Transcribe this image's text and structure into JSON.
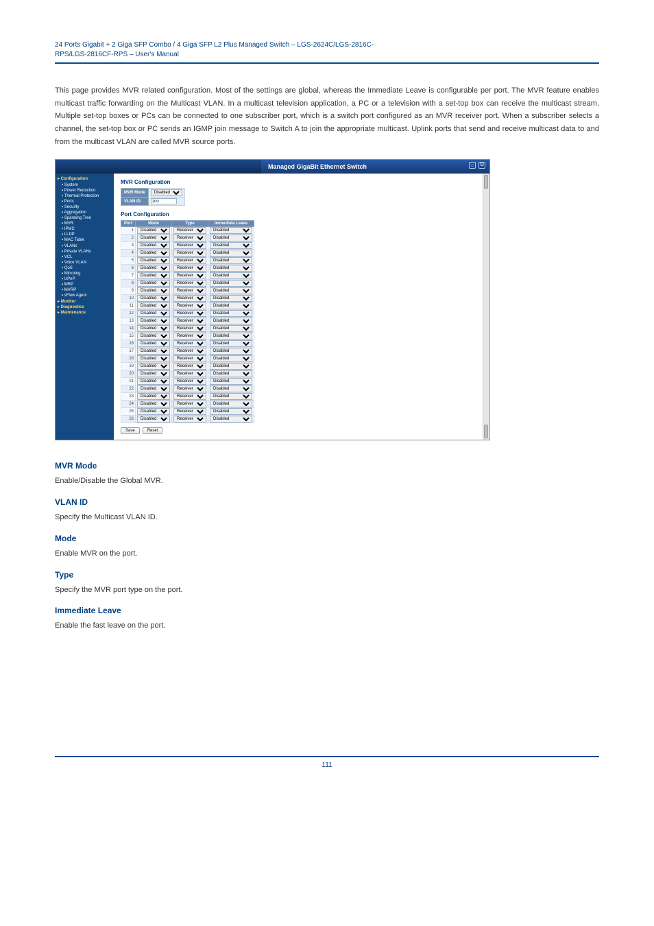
{
  "doc": {
    "title_line": "24 Ports Gigabit + 2 Giga SFP Combo / 4 Giga SFP L2 Plus Managed Switch – LGS-2624C/LGS-2816C-",
    "subtitle_line": "RPS/LGS-2816CF-RPS – User's Manual",
    "intro_para": "This page provides MVR related configuration. Most of the settings are global, whereas the Immediate Leave is configurable per port. The MVR feature enables multicast traffic forwarding on the Multicast VLAN. In a multicast television application, a PC or a television with a set-top box can receive the multicast stream. Multiple set-top boxes or PCs can be connected to one subscriber port, which is a switch port configured as an MVR receiver port. When a subscriber selects a channel, the set-top box or PC sends an IGMP join message to Switch A to join the appropriate multicast. Uplink ports that send and receive multicast data to and from the multicast VLAN are called MVR source ports.",
    "footer": "111"
  },
  "ui": {
    "banner_title": "Managed GigaBit Ethernet Switch",
    "sidebar": {
      "groups": [
        {
          "label": "Configuration",
          "items": [
            "System",
            "Power Reduction",
            "Thermal Protection",
            "Ports",
            "Security",
            "Aggregation",
            "Spanning Tree",
            "MVR",
            "IPMC",
            "LLDP",
            "MAC Table",
            "VLANs",
            "Private VLANs",
            "VCL",
            "Voice VLAN",
            "QoS",
            "Mirroring",
            "UPnP",
            "MRP",
            "MVRP",
            "sFlow Agent"
          ]
        },
        {
          "label": "Monitor",
          "items": []
        },
        {
          "label": "Diagnostics",
          "items": []
        },
        {
          "label": "Maintenance",
          "items": []
        }
      ],
      "active": "MVR"
    },
    "content": {
      "mvr_heading": "MVR Configuration",
      "mvr_mode_label": "MVR Mode",
      "mvr_mode_value": "Disabled",
      "vlan_id_label": "VLAN ID",
      "vlan_id_value": "100",
      "port_heading": "Port Configuration",
      "columns": [
        "Port",
        "Mode",
        "Type",
        "Immediate Leave"
      ],
      "default_mode": "Disabled",
      "default_type": "Receiver",
      "default_leave": "Disabled",
      "num_ports": 26,
      "save_label": "Save",
      "reset_label": "Reset"
    }
  },
  "descriptions": {
    "mvr_mode": {
      "title": "MVR Mode",
      "text": "Enable/Disable the Global MVR."
    },
    "vlan_id": {
      "title": "VLAN ID",
      "text": "Specify the Multicast VLAN ID."
    },
    "mode": {
      "title": "Mode",
      "text": "Enable MVR on the port."
    },
    "type": {
      "title": "Type",
      "text": "Specify the MVR port type on the port."
    },
    "immediate_leave": {
      "title": "Immediate Leave",
      "text": "Enable the fast leave on the port."
    }
  }
}
